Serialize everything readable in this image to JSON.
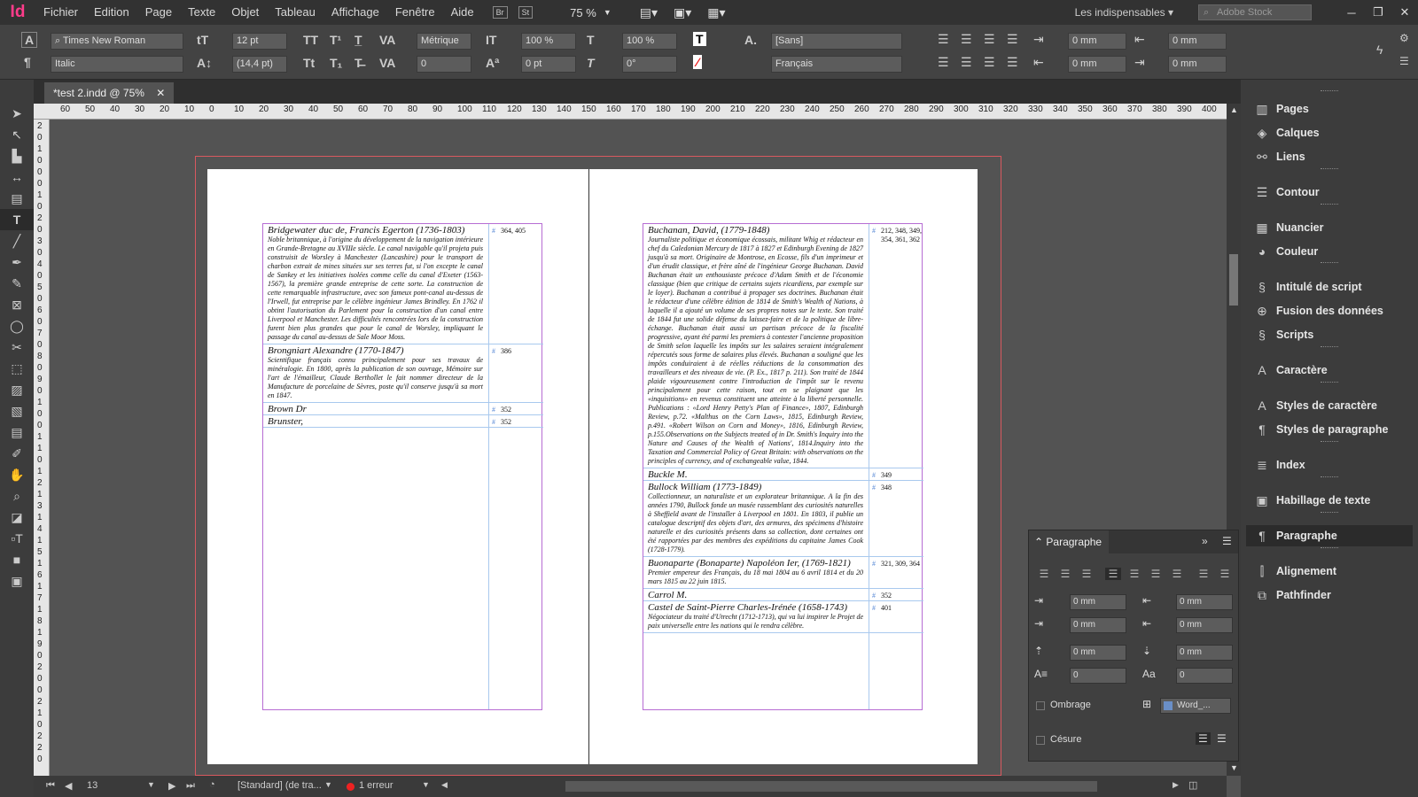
{
  "app": {
    "logo": "Id",
    "zoom": "75 %",
    "workspace": "Les indispensables",
    "search_placeholder": "Adobe Stock",
    "bridge": "Br",
    "stock": "St"
  },
  "menu": [
    "Fichier",
    "Edition",
    "Page",
    "Texte",
    "Objet",
    "Tableau",
    "Affichage",
    "Fenêtre",
    "Aide"
  ],
  "control": {
    "font_family": "Times New Roman",
    "font_style": "Italic",
    "font_size": "12 pt",
    "leading": "(14,4 pt)",
    "kerning": "Métrique",
    "tracking": "0",
    "vscale": "100 %",
    "hscale": "100 %",
    "baseline": "0 pt",
    "skew": "0°",
    "char_style": "[Sans]",
    "language": "Français",
    "indent_left": "0 mm",
    "indent_right": "0 mm",
    "first_line": "0 mm",
    "last_line": "0 mm"
  },
  "document": {
    "tab_title": "*test 2.indd @ 75%",
    "ruler_h": [
      "60",
      "50",
      "40",
      "30",
      "20",
      "10",
      "0",
      "10",
      "20",
      "30",
      "40",
      "50",
      "60",
      "70",
      "80",
      "90",
      "100",
      "110",
      "120",
      "130",
      "140",
      "150",
      "160",
      "170",
      "180",
      "190",
      "200",
      "210",
      "220",
      "230",
      "240",
      "250",
      "260",
      "270",
      "280",
      "290",
      "300",
      "310",
      "320",
      "330",
      "340",
      "350",
      "360",
      "370",
      "380",
      "390",
      "400"
    ],
    "ruler_v": [
      "2",
      "0",
      "1",
      "0",
      "0",
      "0",
      "1",
      "0",
      "2",
      "0",
      "3",
      "0",
      "4",
      "0",
      "5",
      "0",
      "6",
      "0",
      "7",
      "0",
      "8",
      "0",
      "9",
      "0",
      "1",
      "0",
      "0",
      "1",
      "1",
      "0",
      "1",
      "2",
      "1",
      "3",
      "1",
      "4",
      "1",
      "5",
      "1",
      "6",
      "1",
      "7",
      "1",
      "8",
      "1",
      "9",
      "0",
      "2",
      "0",
      "0",
      "2",
      "1",
      "0",
      "2",
      "2",
      "0"
    ]
  },
  "left_entries": [
    {
      "head": "Bridgewater duc de, Francis Egerton (1736-1803)",
      "body": "Noble britannique, à l'origine du développement de la navigation intérieure en Grande-Bretagne au XVIIIe siècle. Le canal navigable qu'il projeta puis construisit de Worsley à Manchester (Lancashire) pour le transport de charbon extrait de mines situées sur ses terres fut, si l'on excepte le canal de Sankey et les initiatives isolées comme celle du canal d'Exeter (1563-1567), la première grande entreprise de cette sorte. La construction de cette remarquable infrastructure, avec son fameux pont-canal au-dessus de l'Irwell, fut entreprise par le célèbre ingénieur James Brindley. En 1762 il obtint l'autorisation du Parlement pour la construction d'un canal entre Liverpool et Manchester. Les difficultés rencontrées lors de la construction furent bien plus grandes que pour le canal de Worsley, impliquant le passage du canal au-dessus de Sale Moor Moss.",
      "pages": "364, 405"
    },
    {
      "head": "Brongniart Alexandre (1770-1847)",
      "body": "Scientifique français connu principalement pour ses travaux de minéralogie. En 1800, après la publication de son ouvrage, Mémoire sur l'art de l'émailleur, Claude Berthollet le fait nommer directeur de la Manufacture de porcelaine de Sèvres, poste qu'il conserve jusqu'à sa mort en 1847.",
      "pages": "386"
    },
    {
      "head": "Brown Dr",
      "body": "",
      "pages": "352"
    },
    {
      "head": "Brunster,",
      "body": "",
      "pages": "352"
    }
  ],
  "right_entries": [
    {
      "head": "Buchanan, David, (1779-1848)",
      "body": "Journaliste politique et économique écossais, militant Whig et rédacteur en chef du Caledonian Mercury de 1817 à 1827 et Edinburgh Evening de 1827 jusqu'à sa mort. Originaire de Montrose, en Ecosse, fils d'un imprimeur et d'un érudit classique, et frère aîné de l'ingénieur George Buchanan. David Buchanan était un enthousiaste précoce d'Adam Smith et de l'économie classique (bien que critique de certains sujets ricardiens, par exemple sur le loyer). Buchanan a contribué à propager ses doctrines. Buchanan était le rédacteur d'une célèbre édition de 1814 de Smith's Wealth of Nations, à laquelle il a ajouté un volume de ses propres notes sur le texte. Son traité de 1844 fut une solide défense du laissez-faire et de la politique de libre-échange. Buchanan était aussi un partisan précoce de la fiscalité progressive, ayant été parmi les premiers à contester l'ancienne proposition de Smith selon laquelle les impôts sur les salaires seraient intégralement répercutés sous forme de salaires plus élevés. Buchanan a souligné que les impôts conduiraient à de réelles réductions de la consommation des travailleurs et des niveaux de vie. (P. Ex., 1817 p. 211). Son traité de 1844 plaide vigoureusement contre l'introduction de l'impôt sur le revenu principalement pour cette raison, tout en se plaignant que les «inquisitions» en revenus constituent une atteinte à la liberté personnelle. Publications : «Lord Henry Petty's Plan of Finance», 1807, Edinburgh Review, p.72. «Malthus on the Corn Laws», 1815, Edinburgh Review, p.491. «Robert Wilson on Corn and Money», 1816, Edinburgh Review, p.155.Observations on the Subjects treated of in Dr. Smith's Inquiry into the Nature and Causes of the Wealth of Nations', 1814.Inquiry into the Taxation and Commercial Policy of Great Britain: with observations on the principles of currency, and of exchangeable value, 1844.",
      "pages": "212, 348, 349, 354, 361, 362"
    },
    {
      "head": "Buckle M.",
      "body": "",
      "pages": "349"
    },
    {
      "head": "Bullock William (1773-1849)",
      "body": "Collectionneur, un naturaliste et un explorateur britannique. A la fin des années 1790, Bullock fonde un musée rassemblant des curiosités naturelles à Sheffield avant de l'installer à Liverpool en 1801. En 1803, il publie un catalogue descriptif des objets d'art, des armures, des spécimens d'histoire naturelle et des curiosités présents dans sa collection, dont certaines ont été rapportées par des membres des expéditions du capitaine James Cook (1728-1779).",
      "pages": "348"
    },
    {
      "head": "Buonaparte (Bonaparte) Napoléon Ier, (1769-1821)",
      "body": "Premier empereur des Français, du 18 mai 1804 au 6 avril 1814 et du 20 mars 1815 au 22 juin 1815.",
      "pages": "321, 309, 364"
    },
    {
      "head": "Carrol M.",
      "body": "",
      "pages": "352"
    },
    {
      "head": "Castel de Saint-Pierre Charles-Irénée (1658-1743)",
      "body": "Négociateur du traité d'Utrecht (1712-1713), qui va lui inspirer le Projet de paix universelle entre les nations qui le rendra célèbre.",
      "pages": "401"
    }
  ],
  "status": {
    "page": "13",
    "style": "[Standard] (de tra...",
    "errors": "1 erreur"
  },
  "panels": [
    {
      "label": "Pages",
      "icon": "pages-icon",
      "glyph": "▥"
    },
    {
      "label": "Calques",
      "icon": "layers-icon",
      "glyph": "◈"
    },
    {
      "label": "Liens",
      "icon": "links-icon",
      "glyph": "⚯"
    },
    {
      "label": "Contour",
      "icon": "stroke-icon",
      "glyph": "☰"
    },
    {
      "label": "Nuancier",
      "icon": "swatches-icon",
      "glyph": "▦"
    },
    {
      "label": "Couleur",
      "icon": "color-icon",
      "glyph": "◕"
    },
    {
      "label": "Intitulé de script",
      "icon": "script-label-icon",
      "glyph": "§"
    },
    {
      "label": "Fusion des données",
      "icon": "data-merge-icon",
      "glyph": "⊕"
    },
    {
      "label": "Scripts",
      "icon": "scripts-icon",
      "glyph": "§"
    },
    {
      "label": "Caractère",
      "icon": "character-icon",
      "glyph": "A"
    },
    {
      "label": "Styles de caractère",
      "icon": "character-styles-icon",
      "glyph": "A"
    },
    {
      "label": "Styles de paragraphe",
      "icon": "paragraph-styles-icon",
      "glyph": "¶"
    },
    {
      "label": "Index",
      "icon": "index-icon",
      "glyph": "≣"
    },
    {
      "label": "Habillage de texte",
      "icon": "text-wrap-icon",
      "glyph": "▣"
    },
    {
      "label": "Paragraphe",
      "icon": "paragraph-icon",
      "glyph": "¶"
    },
    {
      "label": "Alignement",
      "icon": "align-icon",
      "glyph": "⫿"
    },
    {
      "label": "Pathfinder",
      "icon": "pathfinder-icon",
      "glyph": "⧉"
    }
  ],
  "paragraph_panel": {
    "title": "Paragraphe",
    "fields": [
      "0 mm",
      "0 mm",
      "0 mm",
      "0 mm",
      "0 mm",
      "0 mm",
      "0",
      "0"
    ],
    "shading": "Ombrage",
    "shading_swatch": "Word_...",
    "hyphenation": "Césure"
  },
  "colors": {
    "accent_frame": "#b66cd3",
    "bleed": "#d8595f",
    "logo": "#ff3c8b"
  }
}
